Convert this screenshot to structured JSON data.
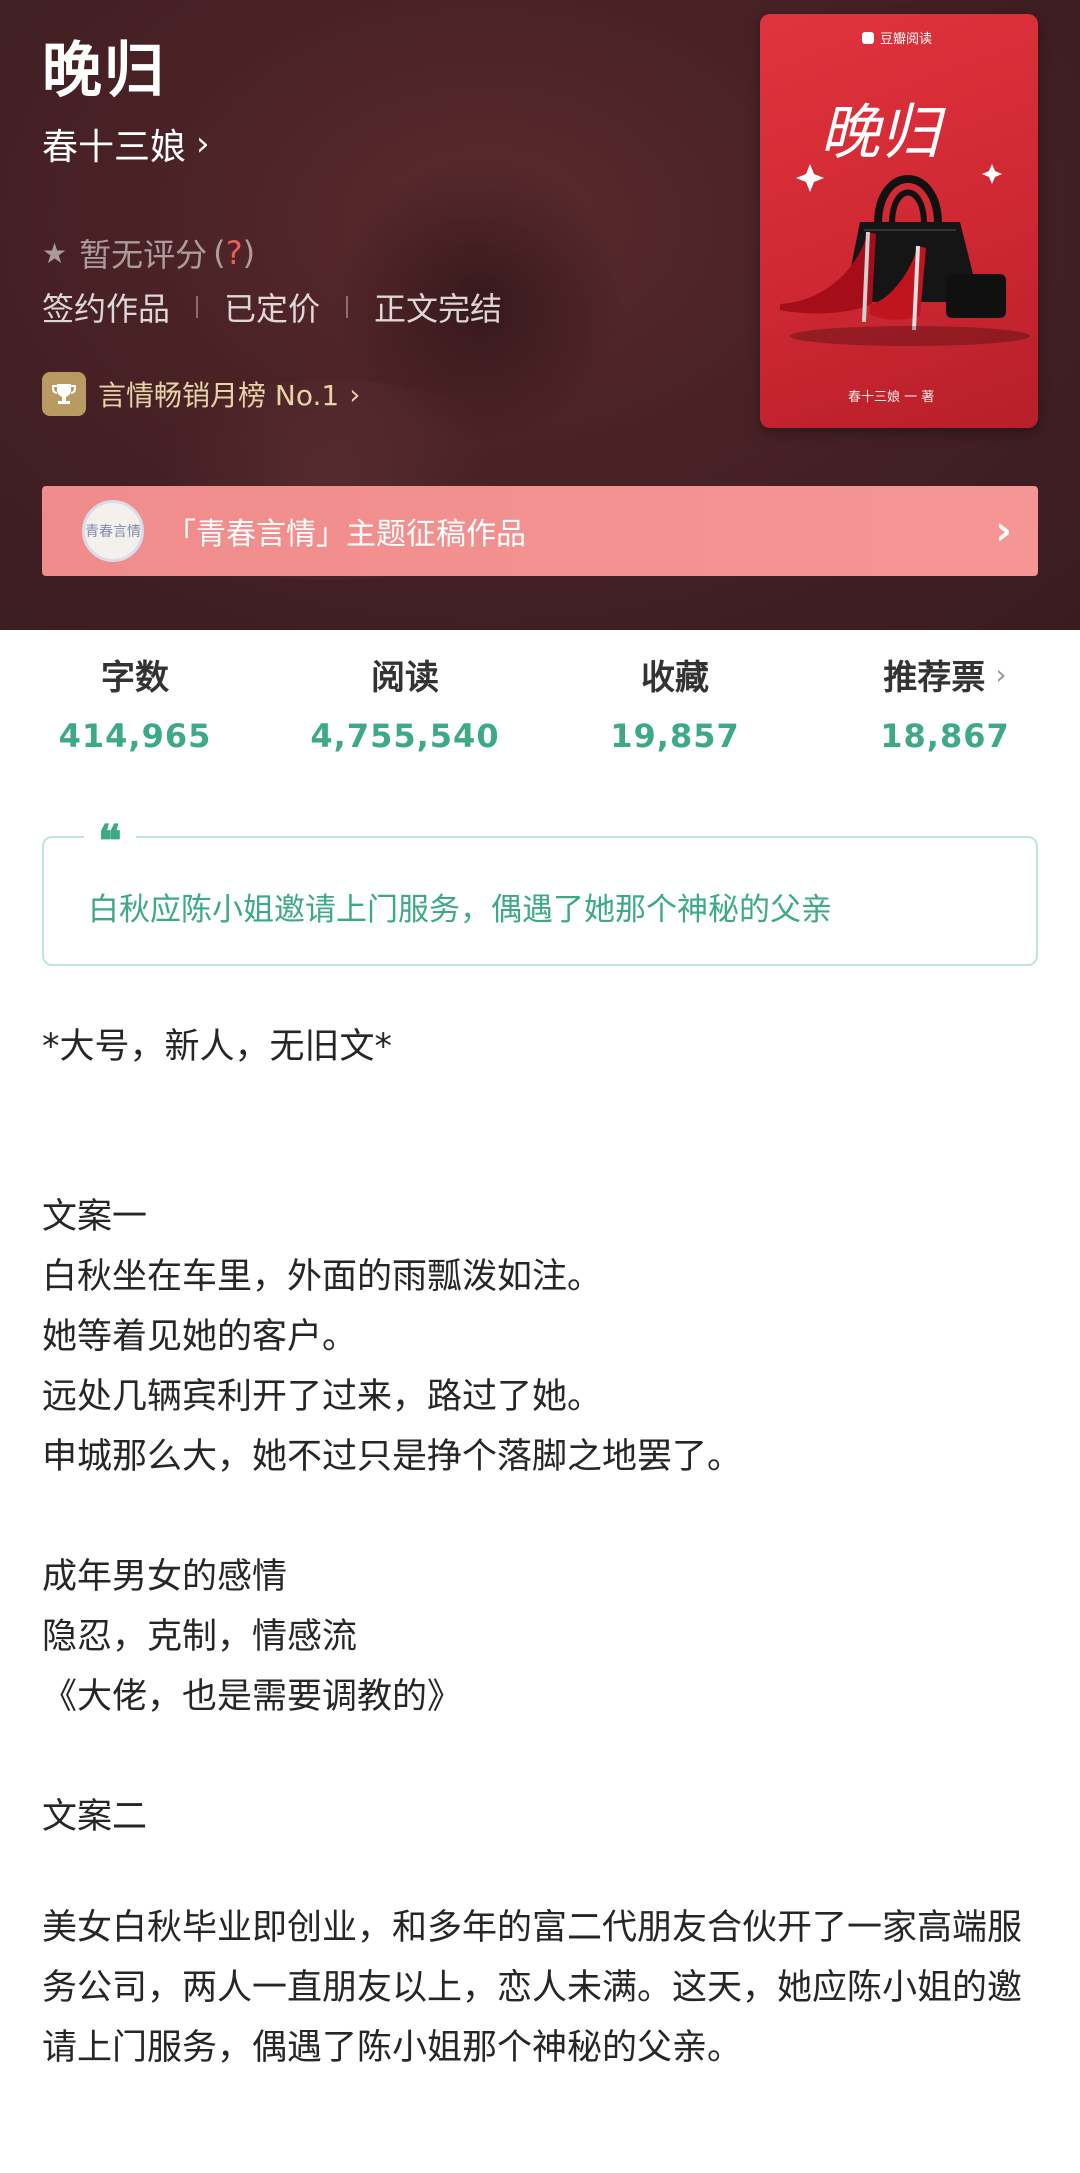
{
  "book": {
    "title": "晚归",
    "author": "春十三娘",
    "rating_text": "暂无评分",
    "rating_help": "?",
    "tags": [
      "签约作品",
      "已定价",
      "正文完结"
    ],
    "rank": "言情畅销月榜 No.1"
  },
  "cover": {
    "publisher": "豆瓣阅读",
    "title": "晚归",
    "author_credit": "春十三娘 一 著"
  },
  "banner": {
    "badge_text": "青春言情",
    "text": "「青春言情」主题征稿作品"
  },
  "stats": [
    {
      "label": "字数",
      "value": "414,965"
    },
    {
      "label": "阅读",
      "value": "4,755,540"
    },
    {
      "label": "收藏",
      "value": "19,857"
    },
    {
      "label": "推荐票",
      "value": "18,867"
    }
  ],
  "quote": {
    "icon": "❝",
    "text": "白秋应陈小姐邀请上门服务，偶遇了她那个神秘的父亲"
  },
  "intro": {
    "note": "*大号，新人，无旧文*",
    "section1_title": "文案一",
    "s1_l1": "白秋坐在车里，外面的雨瓢泼如注。",
    "s1_l2": "她等着见她的客户。",
    "s1_l3": "远处几辆宾利开了过来，路过了她。",
    "s1_l4": "申城那么大，她不过只是挣个落脚之地罢了。",
    "s1b_l1": "成年男女的感情",
    "s1b_l2": "隐忍，克制，情感流",
    "s1b_l3": "《大佬，也是需要调教的》",
    "section2_title": "文案二",
    "s2_para": "美女白秋毕业即创业，和多年的富二代朋友合伙开了一家高端服务公司，两人一直朋友以上，恋人未满。这天，她应陈小姐的邀请上门服务，偶遇了陈小姐那个神秘的父亲。"
  },
  "colors": {
    "accent_green": "#3ea989",
    "banner_pink": "#f08c8c",
    "header_bg": "#4a2226",
    "cover_red": "#d42c37"
  }
}
